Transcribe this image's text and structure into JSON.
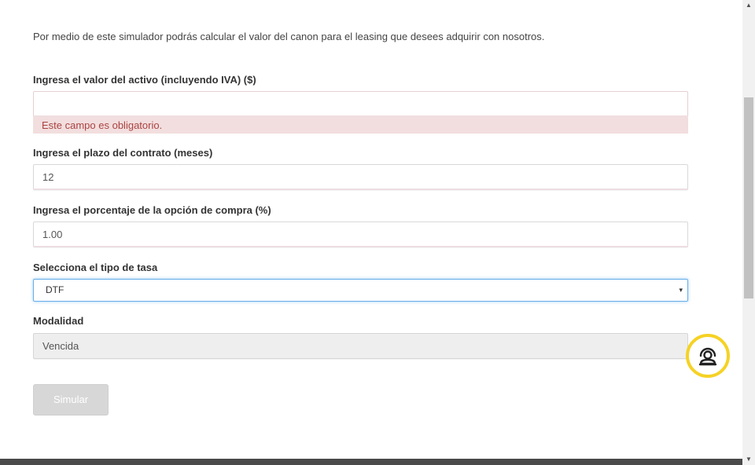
{
  "intro_text": "Por medio de este simulador podrás calcular el valor del canon para el leasing que desees adquirir con nosotros.",
  "asset_value": {
    "label": "Ingresa el valor del activo (incluyendo IVA) ($)",
    "value": "",
    "error": "Este campo es obligatorio."
  },
  "term": {
    "label": "Ingresa el plazo del contrato (meses)",
    "value": "12"
  },
  "purchase_option": {
    "label": "Ingresa el porcentaje de la opción de compra (%)",
    "value": "1.00"
  },
  "rate_type": {
    "label": "Selecciona el tipo de tasa",
    "selected": "DTF",
    "caret_glyph": "▾"
  },
  "modality": {
    "label": "Modalidad",
    "value": "Vencida"
  },
  "simulate_button": "Simular",
  "chat_widget": {
    "icon": "agent-headset-icon",
    "ring_color": "#f5d224"
  },
  "scrollbar": {
    "up_glyph": "▲",
    "down_glyph": "▼"
  },
  "colors": {
    "error_bg": "#f2dede",
    "error_text": "#a94442",
    "focus_border": "#66afe9",
    "button_disabled": "#d7d7d7"
  }
}
